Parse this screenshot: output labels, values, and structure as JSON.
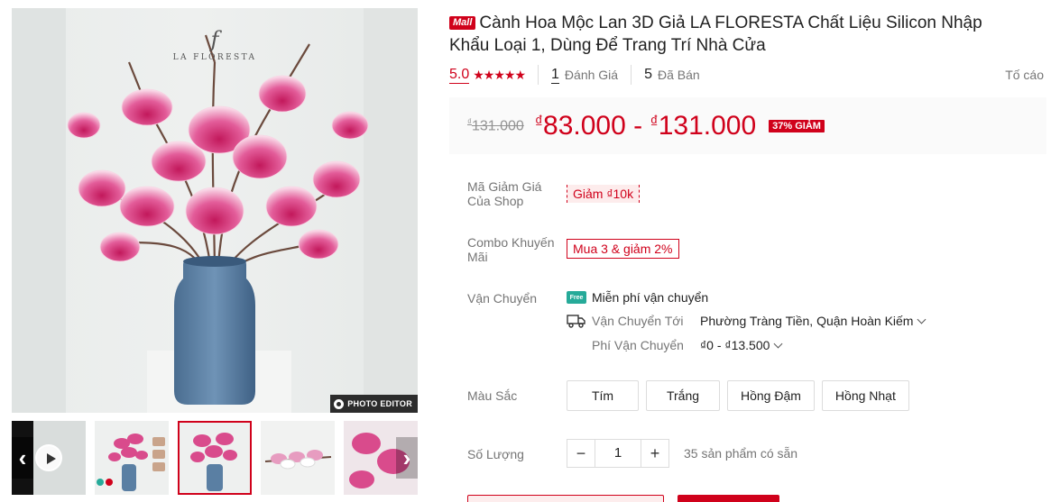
{
  "gallery": {
    "brand_letter": "f",
    "brand_name": "LA FLORESTA",
    "editor_badge": "PHOTO EDITOR"
  },
  "product": {
    "mall_badge": "Mall",
    "title": "Cành Hoa Mộc Lan 3D Giả LA FLORESTA Chất Liệu Silicon Nhập Khẩu Loại 1, Dùng Để Trang Trí Nhà Cửa"
  },
  "stats": {
    "rating": "5.0",
    "stars": "★★★★★",
    "reviews_count": "1",
    "reviews_label": "Đánh Giá",
    "sold_count": "5",
    "sold_label": "Đã Bán",
    "report_label": "Tố cáo"
  },
  "price": {
    "currency": "₫",
    "original": "131.000",
    "min": "83.000",
    "max": "131.000",
    "separator": " - ",
    "discount": "37% GIẢM"
  },
  "voucher": {
    "label": "Mã Giảm Giá Của Shop",
    "chip": "Giảm ₫10k"
  },
  "combo": {
    "label": "Combo Khuyến Mãi",
    "chip": "Mua 3 & giảm 2%"
  },
  "shipping": {
    "label": "Vận Chuyển",
    "free_icon_text": "Free",
    "free_text": "Miễn phí vận chuyển",
    "to_label": "Vận Chuyển Tới",
    "to_value": "Phường Tràng Tiền, Quận Hoàn Kiếm",
    "fee_label": "Phí Vận Chuyển",
    "fee_value": "₫0 - ₫13.500"
  },
  "colors": {
    "label": "Màu Sắc",
    "options": [
      "Tím",
      "Trắng",
      "Hồng Đậm",
      "Hồng Nhạt"
    ]
  },
  "quantity": {
    "label": "Số Lượng",
    "minus": "−",
    "value": "1",
    "plus": "+",
    "stock": "35 sản phẩm có sẵn"
  },
  "theme": {
    "accent": "#d0011b",
    "price_bg": "#fafafa",
    "muted": "#757575"
  }
}
